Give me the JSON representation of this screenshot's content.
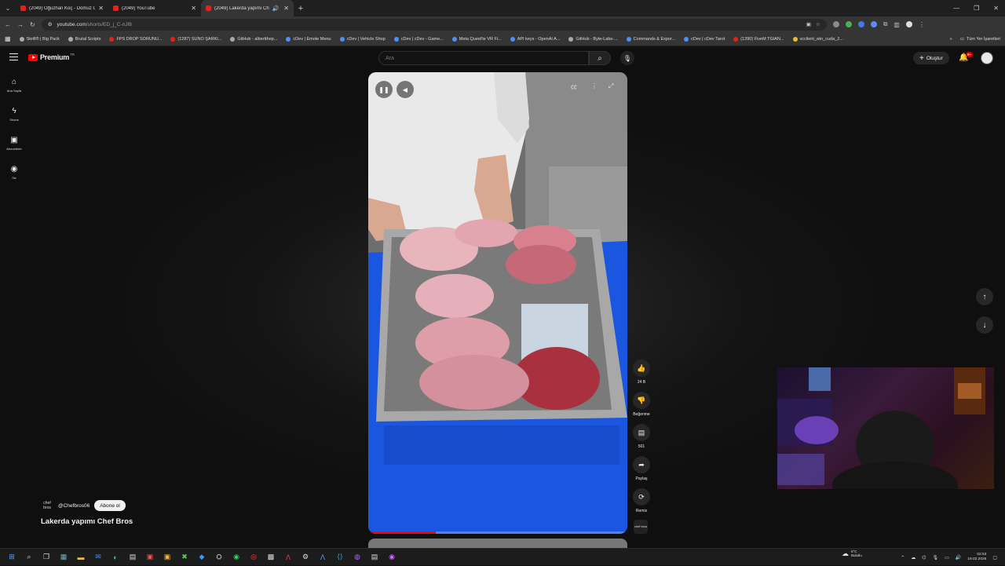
{
  "browser": {
    "tabs": [
      {
        "title": "(2049) Oğuzhan Koç - Domuz G",
        "active": false
      },
      {
        "title": "(2049) YouTube",
        "active": false
      },
      {
        "title": "(2049) Lakerda yapımı Chef",
        "active": true
      }
    ],
    "url_host": "youtube.com",
    "url_path": "/shorts/ED_j_C-nJf8",
    "bookmarks": [
      {
        "label": "Skrill® | Big Pack",
        "color": "gray"
      },
      {
        "label": "Brutal Scripts",
        "color": "gray"
      },
      {
        "label": "FPS DROP SORUNU...",
        "color": "red"
      },
      {
        "label": "(1287) SUNO ŞARKI...",
        "color": "red"
      },
      {
        "label": "GitHub - albertthep...",
        "color": "gray"
      },
      {
        "label": "cDev | Emote Menu",
        "color": "blue"
      },
      {
        "label": "cDev | Vehicle Shop",
        "color": "blue"
      },
      {
        "label": "cDev | cDev - Game...",
        "color": "blue"
      },
      {
        "label": "Meta Quest'te VR Fi...",
        "color": "blue"
      },
      {
        "label": "API keys - OpenAI A...",
        "color": "blue"
      },
      {
        "label": "GitHub - Byte-Labs-...",
        "color": "gray"
      },
      {
        "label": "Commands & Expor...",
        "color": "blue"
      },
      {
        "label": "cDev | cDev Tarot",
        "color": "blue"
      },
      {
        "label": "(1390) FiveM TGIAN...",
        "color": "red"
      },
      {
        "label": "vcclient_win_cuda_2...",
        "color": "yellow"
      }
    ],
    "all_bookmarks_label": "Tüm Yer İşaretleri"
  },
  "header": {
    "logo_text": "Premium",
    "country_code": "TR",
    "search_placeholder": "Ara",
    "create_label": "Oluştur",
    "notification_count": "9+"
  },
  "guide": [
    {
      "label": "Ana Sayfa",
      "icon": "home-icon"
    },
    {
      "label": "Shorts",
      "icon": "shorts-icon"
    },
    {
      "label": "Abonelikler",
      "icon": "subscriptions-icon"
    },
    {
      "label": "Siz",
      "icon": "you-icon"
    }
  ],
  "short": {
    "channel_handle": "@Chefbros06",
    "channel_logo_text": "chef bros",
    "subscribe_label": "Abone ol",
    "title": "Lakerda yapımı Chef Bros",
    "progress": 0.26,
    "actions": {
      "like_count": "24 B",
      "dislike_label": "Beğenme",
      "comment_count": "501",
      "share_label": "Paylaş",
      "remix_label": "Remix"
    }
  },
  "taskbar": {
    "weather_temp": "6°C",
    "weather_desc": "Bulutlu",
    "time": "02:53",
    "date": "19.02.2026"
  }
}
